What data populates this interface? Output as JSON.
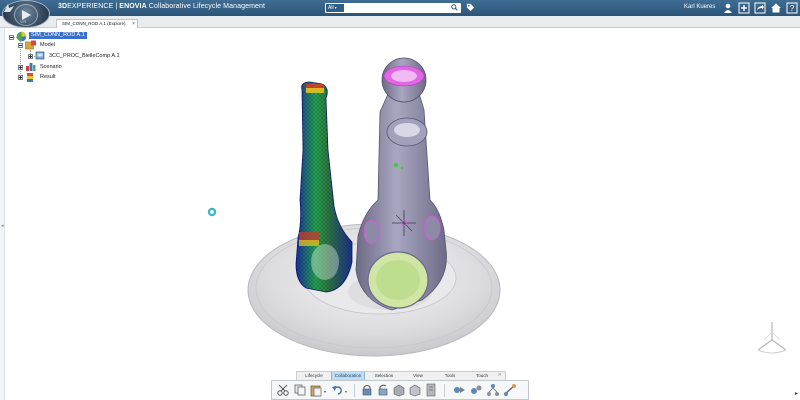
{
  "topbar": {
    "brand_prefix": "3D",
    "brand_rest": "EXPERIENCE | ",
    "product": "ENOVIA",
    "subtitle": " Collaborative Lifecycle Management",
    "search_scope": "All",
    "search_placeholder": "",
    "user_name": "Karl Kueres",
    "compass_version": "V.R",
    "accent_color": "#2b5578"
  },
  "tabs": [
    {
      "label": "SIM_CONN_ROD A.1 (Explore)",
      "close": "×"
    }
  ],
  "tree": {
    "root": "SIM_CONN_ROD A.1",
    "children": [
      {
        "label": "Model",
        "icon": "model-folder-icon",
        "expanded": true
      },
      {
        "label": "3CC_PROC_BielleComp A.1",
        "icon": "part-icon"
      },
      {
        "label": "Scenario",
        "icon": "scenario-icon",
        "expanded": false
      },
      {
        "label": "Result",
        "icon": "result-icon",
        "expanded": false
      }
    ]
  },
  "action_bar": {
    "tabs": [
      "Lifecycle",
      "Collaboration",
      "Selection",
      "View",
      "Tools",
      "Touch"
    ],
    "active_tab": "Collaboration",
    "more": "»",
    "tools": [
      "cut-icon",
      "copy-icon",
      "paste-icon",
      "undo-icon",
      "lock-icon",
      "unlock-icon",
      "reserve-icon",
      "unreserve-icon",
      "document-icon",
      "compare-icon",
      "update-icon",
      "structure-icon",
      "measure-icon"
    ]
  },
  "viewport": {
    "background": "#ffffff",
    "mesh_colors": [
      "#2a3ec9",
      "#1fbf4a",
      "#e6d21a",
      "#d5342a"
    ],
    "part_color": "#8d8aa8",
    "highlight_color": "#e14fe6"
  }
}
